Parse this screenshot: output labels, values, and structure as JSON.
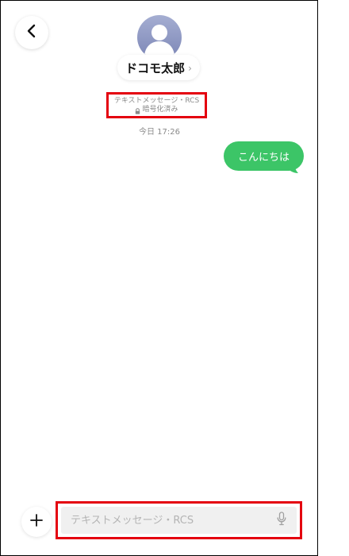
{
  "header": {
    "contact_name": "ドコモ太郎",
    "chevron": "›",
    "back_icon": "chevron-left-icon",
    "avatar_icon": "person-silhouette-icon"
  },
  "conversation": {
    "service_label": "テキストメッセージ・RCS",
    "encryption_label": "暗号化済み",
    "lock_icon": "lock-icon",
    "timestamp": "今日 17:26",
    "messages": [
      {
        "direction": "outgoing",
        "text": "こんにちは"
      }
    ]
  },
  "composer": {
    "placeholder": "テキストメッセージ・RCS",
    "value": "",
    "add_icon": "plus-icon",
    "mic_icon": "microphone-icon"
  },
  "colors": {
    "outgoing_bubble": "#3cc567",
    "highlight_border": "#e4000f",
    "avatar": "#8c96c4"
  }
}
